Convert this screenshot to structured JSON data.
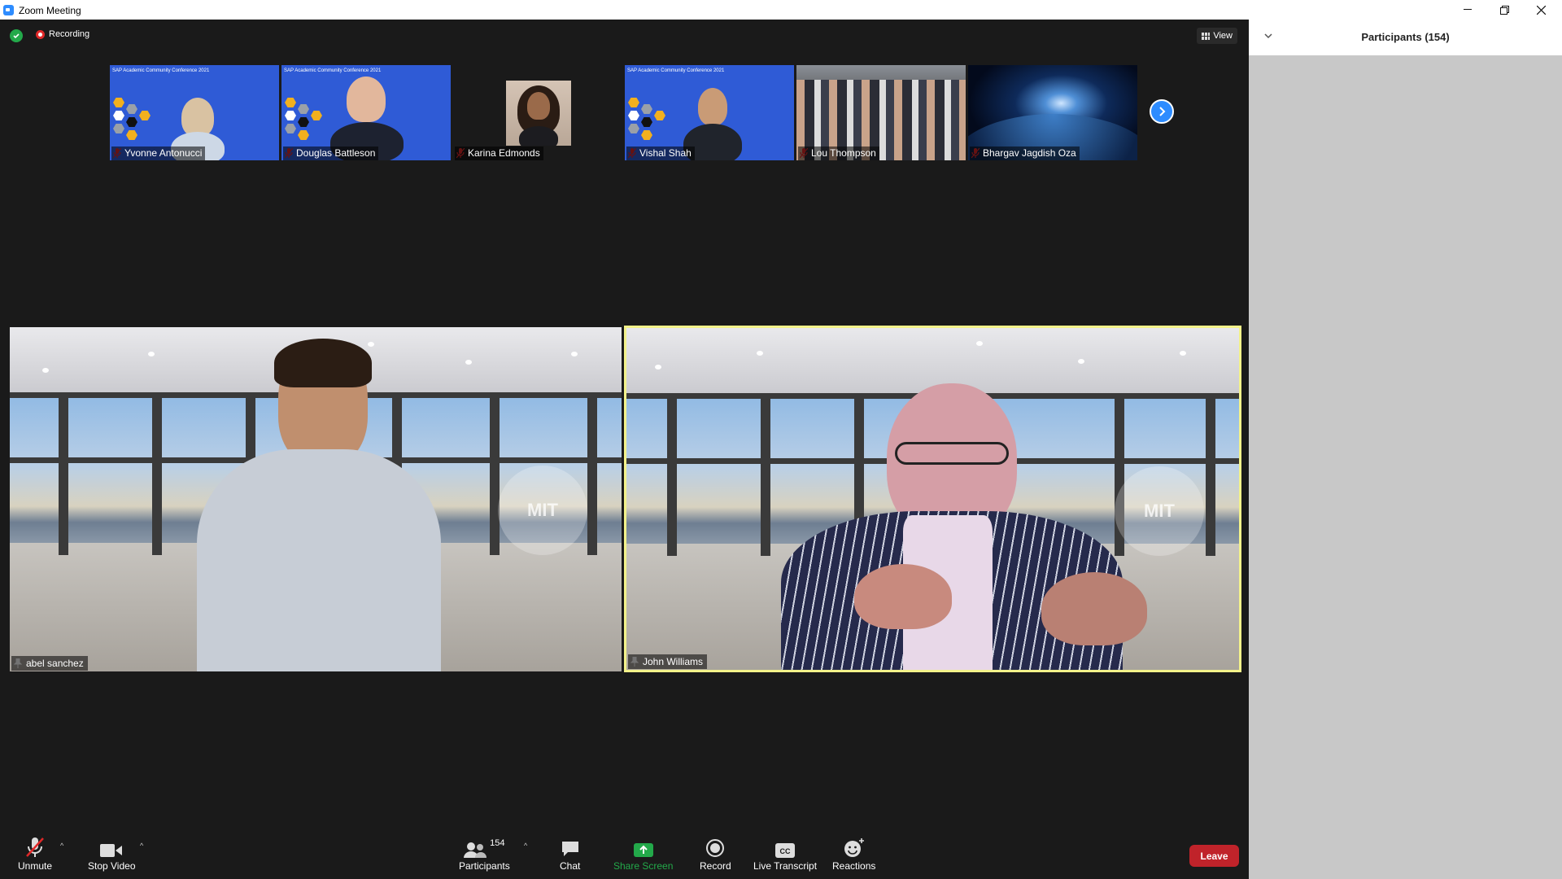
{
  "window": {
    "title": "Zoom Meeting",
    "minimize_icon": "minimize-icon",
    "restore_icon": "restore-icon",
    "close_icon": "close-icon"
  },
  "meeting": {
    "recording_label": "Recording",
    "view_label": "View",
    "gallery": [
      {
        "name": "Yvonne Antonucci",
        "muted": true
      },
      {
        "name": "Douglas Battleson",
        "muted": true
      },
      {
        "name": "Karina Edmonds",
        "muted": true
      },
      {
        "name": "Vishal Shah",
        "muted": true
      },
      {
        "name": "Lou Thompson",
        "muted": true
      },
      {
        "name": "Bhargav Jagdish Oza",
        "muted": true
      }
    ],
    "sap_slide_text": "SAP Academic Community Conference 2021",
    "speakers": [
      {
        "name": "abel sanchez",
        "pinned": true,
        "active": false
      },
      {
        "name": "John Williams",
        "pinned": true,
        "active": true
      }
    ],
    "active_border_color": "#f3f28a"
  },
  "toolbar": {
    "unmute_label": "Unmute",
    "stop_video_label": "Stop Video",
    "participants_label": "Participants",
    "participants_count": "154",
    "chat_label": "Chat",
    "share_screen_label": "Share Screen",
    "record_label": "Record",
    "live_transcript_label": "Live Transcript",
    "reactions_label": "Reactions",
    "leave_label": "Leave",
    "share_color": "#23a94a",
    "leave_color": "#c0232a"
  },
  "sidebar": {
    "title": "Participants (154)"
  }
}
